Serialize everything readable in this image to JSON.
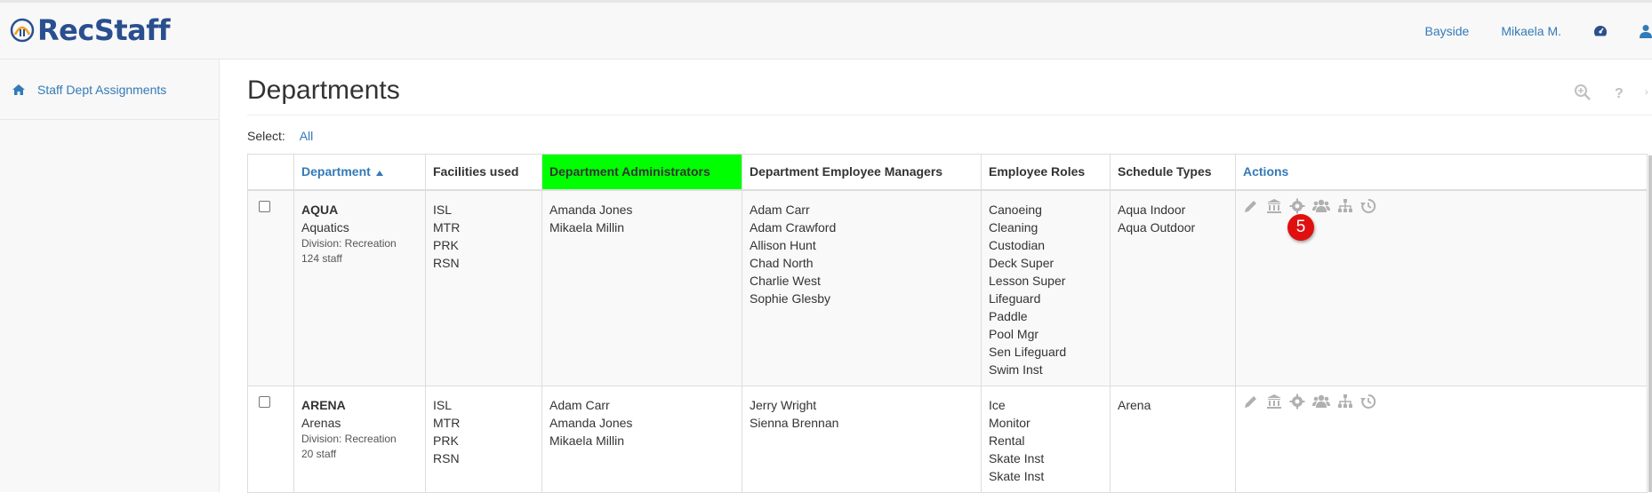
{
  "brand": {
    "name": "RecStaff"
  },
  "nav": {
    "location": "Bayside",
    "user": "Mikaela M.",
    "dashboard_icon": "dashboard-icon",
    "user_icon": "user-icon"
  },
  "sidebar": {
    "items": [
      {
        "label": "Staff Dept Assignments",
        "icon": "home-icon"
      }
    ]
  },
  "page": {
    "title": "Departments",
    "select_label": "Select:",
    "select_all": "All"
  },
  "table": {
    "headers": {
      "department": "Department",
      "facilities": "Facilities used",
      "administrators": "Department Administrators",
      "managers": "Department Employee Managers",
      "roles": "Employee Roles",
      "schedule_types": "Schedule Types",
      "actions": "Actions"
    },
    "highlight_color": "#00ff00",
    "rows": [
      {
        "code": "AQUA",
        "name": "Aquatics",
        "division": "Division: Recreation",
        "staff": "124 staff",
        "facilities": [
          "ISL",
          "MTR",
          "PRK",
          "RSN"
        ],
        "administrators": [
          "Amanda Jones",
          "Mikaela Millin"
        ],
        "managers": [
          "Adam Carr",
          "Adam Crawford",
          "Allison Hunt",
          "Chad North",
          "Charlie West",
          "Sophie Glesby"
        ],
        "roles": [
          "Canoeing",
          "Cleaning",
          "Custodian",
          "Deck Super",
          "Lesson Super",
          "Lifeguard",
          "Paddle",
          "Pool Mgr",
          "Sen Lifeguard",
          "Swim Inst"
        ],
        "schedule_types": [
          "Aqua Indoor",
          "Aqua Outdoor"
        ],
        "badge": "5"
      },
      {
        "code": "ARENA",
        "name": "Arenas",
        "division": "Division: Recreation",
        "staff": "20 staff",
        "facilities": [
          "ISL",
          "MTR",
          "PRK",
          "RSN"
        ],
        "administrators": [
          "Adam Carr",
          "Amanda Jones",
          "Mikaela Millin"
        ],
        "managers": [
          "Jerry Wright",
          "Sienna Brennan"
        ],
        "roles": [
          "Ice",
          "Monitor",
          "Rental",
          "Skate Inst",
          "Skate Inst"
        ],
        "schedule_types": [
          "Arena"
        ]
      }
    ]
  }
}
